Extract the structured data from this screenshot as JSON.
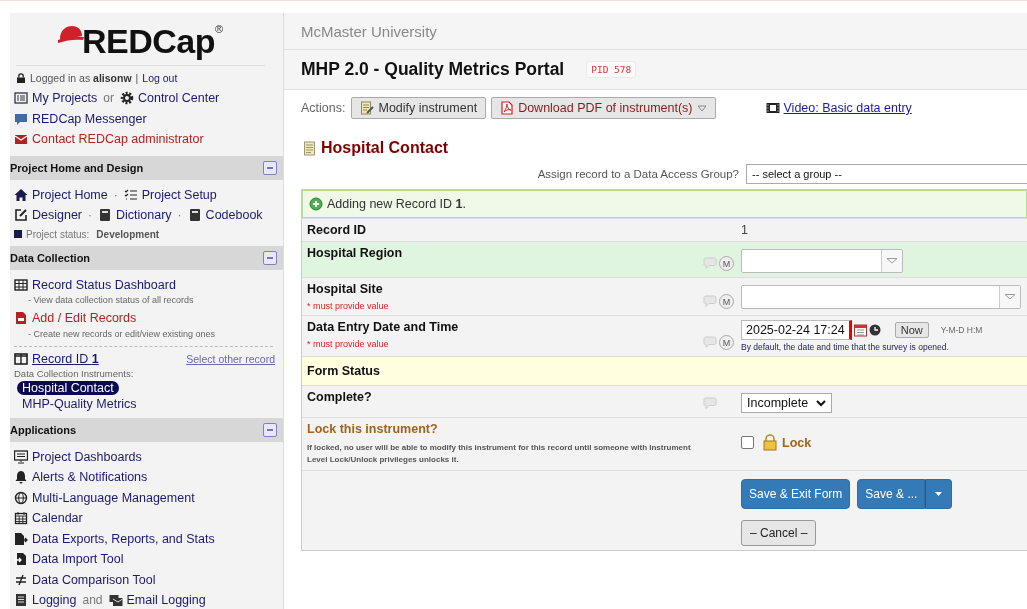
{
  "sidebar": {
    "logo": "REDCap",
    "logo_mark": "®",
    "login": {
      "prefix": "Logged in as",
      "user": "alisonw",
      "separator": "|",
      "logout": "Log out"
    },
    "top_lines": [
      [
        {
          "kind": "link",
          "label": "My Projects"
        },
        {
          "kind": "joiner",
          "text": "or"
        },
        {
          "kind": "link",
          "label": "Control Center"
        }
      ],
      [
        {
          "kind": "link",
          "label": "REDCap Messenger"
        }
      ],
      [
        {
          "kind": "alert",
          "label": "Contact REDCap administrator"
        }
      ]
    ],
    "sections": [
      {
        "title": "Project Home and Design",
        "expanded": true,
        "blocks": [
          {
            "kind": "line",
            "parts": [
              {
                "kind": "link",
                "label": "Project Home"
              },
              {
                "kind": "joiner",
                "text": "·"
              },
              {
                "kind": "link",
                "label": "Project Setup"
              }
            ]
          },
          {
            "kind": "line",
            "parts": [
              {
                "kind": "link",
                "label": "Designer"
              },
              {
                "kind": "joiner",
                "text": "·"
              },
              {
                "kind": "link",
                "label": "Dictionary"
              },
              {
                "kind": "joiner",
                "text": "·"
              },
              {
                "kind": "link",
                "label": "Codebook"
              }
            ]
          },
          {
            "kind": "status",
            "label": "Project status:",
            "value": "Development"
          }
        ]
      },
      {
        "title": "Data Collection",
        "expanded": true,
        "blocks": [
          {
            "kind": "line",
            "parts": [
              {
                "kind": "link",
                "label": "Record Status Dashboard"
              }
            ]
          },
          {
            "kind": "desc",
            "text": "- View data collection status of all records"
          },
          {
            "kind": "line",
            "parts": [
              {
                "kind": "alert",
                "label": "Add / Edit Records"
              }
            ]
          },
          {
            "kind": "desc",
            "text": "- Create new records or edit/view existing ones"
          },
          {
            "kind": "divider"
          },
          {
            "kind": "record",
            "link": "Record ID **1**",
            "other": "Select other record"
          },
          {
            "kind": "caption",
            "text": "Data Collection Instruments:"
          },
          {
            "kind": "instruments",
            "items": [
              {
                "label": "Hospital Contact",
                "selected": true
              },
              {
                "label": "MHP-Quality Metrics",
                "selected": false
              }
            ]
          }
        ]
      },
      {
        "title": "Applications",
        "expanded": true,
        "blocks": [
          {
            "kind": "line",
            "parts": [
              {
                "kind": "link",
                "label": "Project Dashboards"
              }
            ]
          },
          {
            "kind": "line",
            "parts": [
              {
                "kind": "link",
                "label": "Alerts & Notifications"
              }
            ]
          },
          {
            "kind": "line",
            "parts": [
              {
                "kind": "link",
                "label": "Multi-Language Management"
              }
            ]
          },
          {
            "kind": "line",
            "parts": [
              {
                "kind": "link",
                "label": "Calendar"
              }
            ]
          },
          {
            "kind": "line",
            "parts": [
              {
                "kind": "link",
                "label": "Data Exports, Reports, and Stats"
              }
            ]
          },
          {
            "kind": "line",
            "parts": [
              {
                "kind": "link",
                "label": "Data Import Tool"
              }
            ]
          },
          {
            "kind": "line",
            "parts": [
              {
                "kind": "link",
                "label": "Data Comparison Tool"
              }
            ]
          },
          {
            "kind": "line",
            "parts": [
              {
                "kind": "link",
                "label": "Logging"
              },
              {
                "kind": "joiner",
                "text": "and"
              },
              {
                "kind": "link",
                "label": "Email Logging"
              }
            ]
          }
        ]
      }
    ]
  },
  "header": {
    "institution": "McMaster University",
    "project_title": "MHP 2.0 - Quality Metrics Portal",
    "pid": "PID 578"
  },
  "actions": {
    "label": "Actions:",
    "buttons": [
      {
        "label": "Modify instrument",
        "kind": "plain"
      },
      {
        "label": "Download PDF of instrument(s)",
        "kind": "pdf"
      }
    ],
    "video_link": "Video: Basic data entry"
  },
  "form": {
    "title": "Hospital Contact",
    "dag": {
      "label": "Assign record to a Data Access Group?",
      "value": "-- select a group --"
    },
    "notice": "Adding new Record ID **1**.",
    "rows": [
      {
        "kind": "text",
        "label": "Record ID",
        "value": "1",
        "highlighted": false
      },
      {
        "kind": "dropdown",
        "label": "Hospital Region",
        "badge": "M",
        "highlighted": true
      },
      {
        "kind": "dropdown",
        "label": "Hospital Site",
        "note": "* must provide value",
        "badge": "M",
        "highlighted": false
      },
      {
        "kind": "datetime",
        "label": "Data Entry Date and Time",
        "note": "* must provide value",
        "badge": "M",
        "value": "2025-02-24 17:24",
        "now": "Now",
        "format": "Y-M-D H:M",
        "hint": "By default, the date and time that the survey is opened.",
        "highlighted": false
      },
      {
        "kind": "header",
        "label": "Form Status"
      },
      {
        "kind": "select",
        "label": "Complete?",
        "value": "Incomplete",
        "highlighted": false
      },
      {
        "kind": "lock",
        "label": "Lock this instrument?",
        "desc": "If locked, no user will be able to modify this instrument for this record until someone with Instrument Level Lock/Unlock privileges unlocks it.",
        "checked": false,
        "option": "Lock"
      },
      {
        "kind": "actions",
        "primary": "Save & Exit Form",
        "split": "Save & ...",
        "cancel": "– Cancel –"
      }
    ]
  }
}
